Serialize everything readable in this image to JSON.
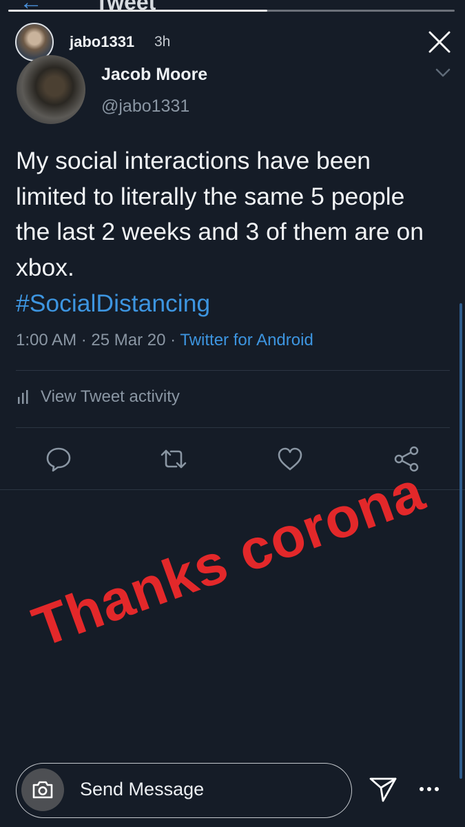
{
  "story": {
    "username": "jabo1331",
    "time_ago": "3h",
    "progress": 0.58,
    "icons": {
      "close": "close-icon"
    }
  },
  "tweet_view": {
    "header_title": "Tweet",
    "back_icon": "back-arrow-icon"
  },
  "tweet": {
    "author_name": "Jacob Moore",
    "author_handle": "@jabo1331",
    "text": "My social interactions have been limited to literally the same 5 people the last 2 weeks and 3 of them are on xbox.",
    "hashtag": "#SocialDistancing",
    "time": "1:00 AM",
    "date": "25 Mar 20",
    "separator": "·",
    "source": "Twitter for Android",
    "activity_label": "View Tweet activity",
    "actions": [
      "reply-icon",
      "retweet-icon",
      "like-icon",
      "share-icon"
    ]
  },
  "sticker": {
    "text": "Thanks corona",
    "color": "#e3282a"
  },
  "composer": {
    "placeholder": "Send Message",
    "camera_icon": "camera-icon",
    "send_icon": "paper-plane-icon",
    "more_icon": "more-icon"
  },
  "colors": {
    "background": "#151c27",
    "link": "#3d95e0",
    "muted": "#8a96a3"
  }
}
